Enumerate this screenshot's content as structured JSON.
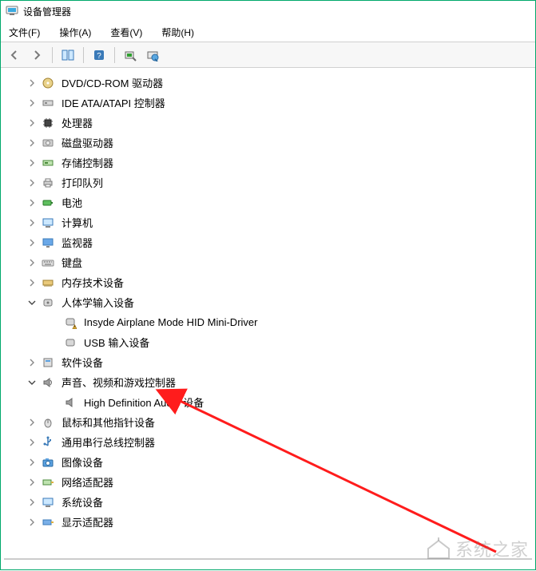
{
  "window": {
    "title": "设备管理器"
  },
  "menu": {
    "file": "文件(F)",
    "action": "操作(A)",
    "view": "查看(V)",
    "help": "帮助(H)"
  },
  "tree": {
    "dvd": {
      "label": "DVD/CD-ROM 驱动器"
    },
    "ide": {
      "label": "IDE ATA/ATAPI 控制器"
    },
    "cpu": {
      "label": "处理器"
    },
    "disk": {
      "label": "磁盘驱动器"
    },
    "storage": {
      "label": "存储控制器"
    },
    "printq": {
      "label": "打印队列"
    },
    "battery": {
      "label": "电池"
    },
    "computer": {
      "label": "计算机"
    },
    "monitor": {
      "label": "监视器"
    },
    "keyboard": {
      "label": "键盘"
    },
    "memorytech": {
      "label": "内存技术设备"
    },
    "hid": {
      "label": "人体学输入设备"
    },
    "hid_airplane": {
      "label": "Insyde Airplane Mode HID Mini-Driver"
    },
    "hid_usb": {
      "label": "USB 输入设备"
    },
    "software": {
      "label": "软件设备"
    },
    "sound": {
      "label": "声音、视频和游戏控制器"
    },
    "sound_hda": {
      "label": "High Definition Audio 设备"
    },
    "mouse": {
      "label": "鼠标和其他指针设备"
    },
    "usb": {
      "label": "通用串行总线控制器"
    },
    "imaging": {
      "label": "图像设备"
    },
    "network": {
      "label": "网络适配器"
    },
    "system": {
      "label": "系统设备"
    },
    "display": {
      "label": "显示适配器"
    }
  },
  "watermark": {
    "text": "系统之家"
  }
}
